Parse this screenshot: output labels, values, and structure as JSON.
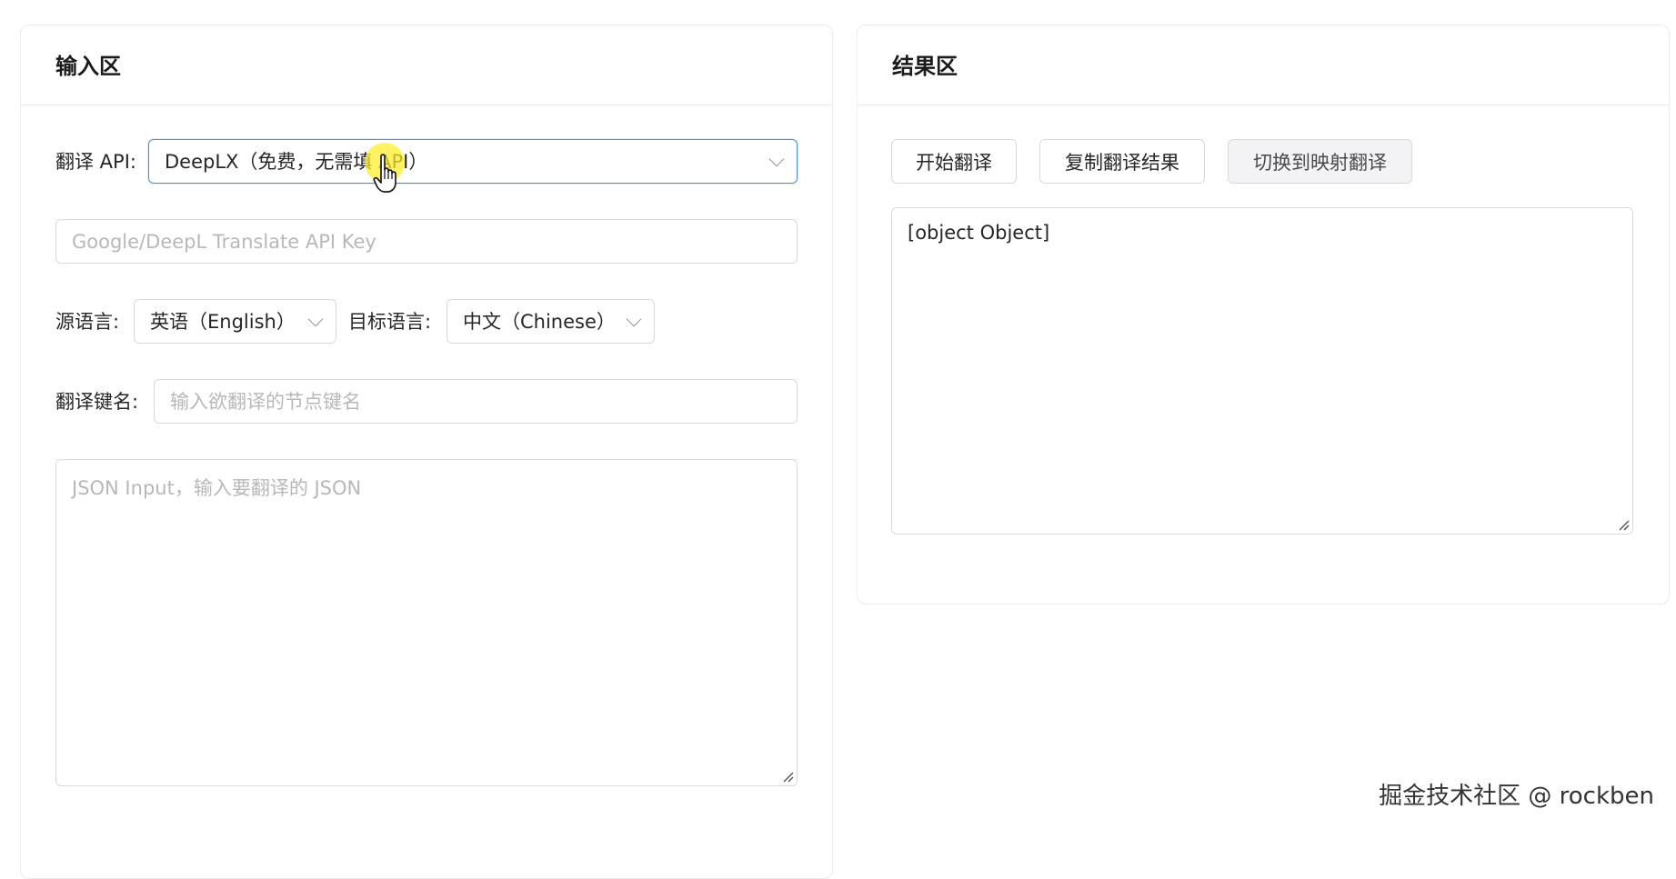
{
  "input_panel": {
    "title": "输入区",
    "api_label": "翻译 API:",
    "api_selected": "DeepLX（免费，无需填 API）",
    "api_key_placeholder": "Google/DeepL Translate API Key",
    "source_lang_label": "源语言:",
    "source_lang_value": "英语（English）",
    "target_lang_label": "目标语言:",
    "target_lang_value": "中文（Chinese）",
    "key_name_label": "翻译键名:",
    "key_name_placeholder": "输入欲翻译的节点键名",
    "json_input_placeholder": "JSON Input，输入要翻译的 JSON"
  },
  "result_panel": {
    "title": "结果区",
    "start_button": "开始翻译",
    "copy_button": "复制翻译结果",
    "switch_button": "切换到映射翻译",
    "result_value": "[object Object]"
  },
  "watermark": "掘金技术社区 @ rockben",
  "colors": {
    "focus_border": "#4a90d9",
    "cursor_highlight": "#ffee28",
    "secondary_button_bg": "#f3f3f5"
  },
  "icons": {
    "select_arrow": "chevron-down-icon",
    "resize_handle": "resize-grip-icon",
    "mouse_cursor": "hand-pointer-icon"
  }
}
